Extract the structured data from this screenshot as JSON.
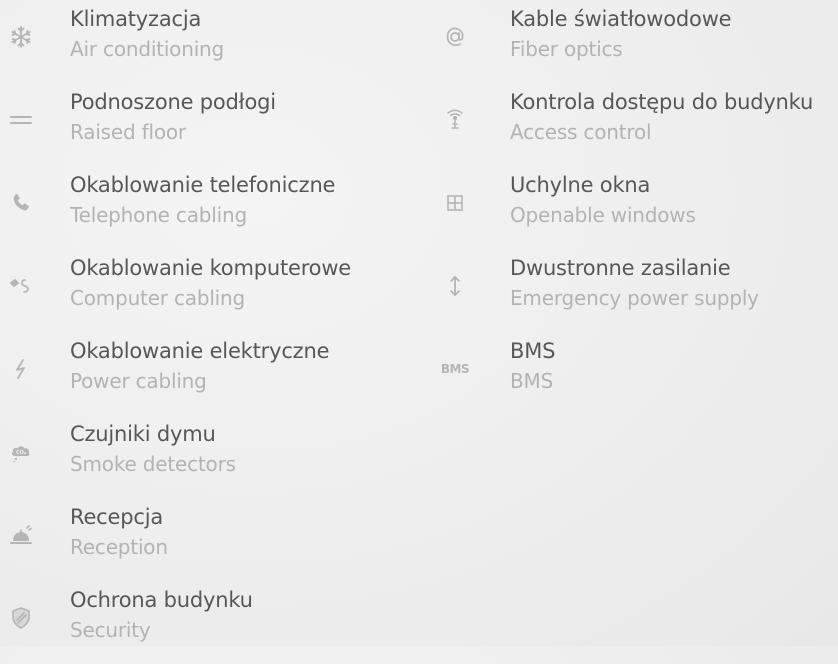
{
  "left_column": [
    {
      "icon": "snowflake-icon",
      "pl": "Klimatyzacja",
      "en": "Air conditioning"
    },
    {
      "icon": "raised-floor-icon",
      "pl": "Podnoszone podłogi",
      "en": "Raised floor"
    },
    {
      "icon": "phone-icon",
      "pl": "Okablowanie telefoniczne",
      "en": "Telephone cabling"
    },
    {
      "icon": "computer-cable-icon",
      "pl": "Okablowanie komputerowe",
      "en": "Computer cabling"
    },
    {
      "icon": "lightning-icon",
      "pl": "Okablowanie elektryczne",
      "en": "Power cabling"
    },
    {
      "icon": "smoke-cloud-icon",
      "pl": "Czujniki dymu",
      "en": "Smoke detectors"
    },
    {
      "icon": "reception-bell-icon",
      "pl": "Recepcja",
      "en": "Reception"
    },
    {
      "icon": "shield-icon",
      "pl": "Ochrona budynku",
      "en": "Security"
    }
  ],
  "right_column": [
    {
      "icon": "at-sign-icon",
      "pl": "Kable światłowodowe",
      "en": "Fiber optics"
    },
    {
      "icon": "antenna-icon",
      "pl": "Kontrola dostępu do budynku",
      "en": "Access control"
    },
    {
      "icon": "window-icon",
      "pl": "Uchylne okna",
      "en": "Openable windows"
    },
    {
      "icon": "updown-arrow-icon",
      "pl": "Dwustronne zasilanie",
      "en": "Emergency power supply"
    },
    {
      "icon": "bms-icon",
      "pl": "BMS",
      "en": "BMS",
      "icon_text": "BMS"
    }
  ],
  "colors": {
    "background": "#f0f0f0",
    "label_primary": "#575757",
    "label_secondary": "#b3b3b3",
    "icon": "#b5b5b5"
  }
}
